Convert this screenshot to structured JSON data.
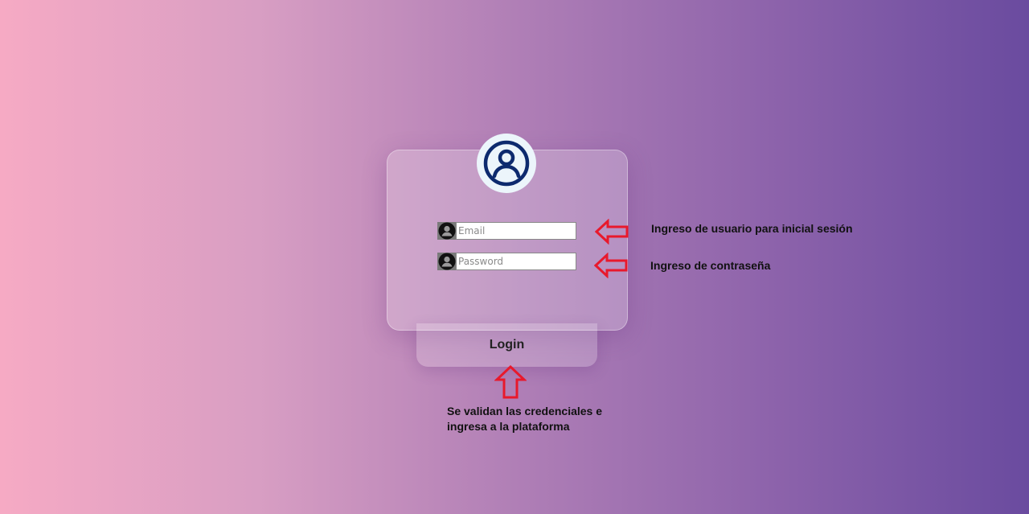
{
  "login_form": {
    "avatar_icon": "user-circle-icon",
    "email": {
      "icon": "user-icon",
      "placeholder": "Email",
      "value": ""
    },
    "password": {
      "icon": "user-icon",
      "placeholder": "Password",
      "value": ""
    },
    "login_label": "Login"
  },
  "annotations": {
    "email_note": "Ingreso de usuario para inicial sesión",
    "password_note": "Ingreso de contraseña",
    "login_note_line1": "Se validan las credenciales e",
    "login_note_line2": "ingresa a la plataforma"
  },
  "colors": {
    "arrow": "#e8192c",
    "avatar_stroke": "#0d2a6e",
    "gradient_left": "#f6aac4",
    "gradient_right": "#6a4b9f"
  }
}
